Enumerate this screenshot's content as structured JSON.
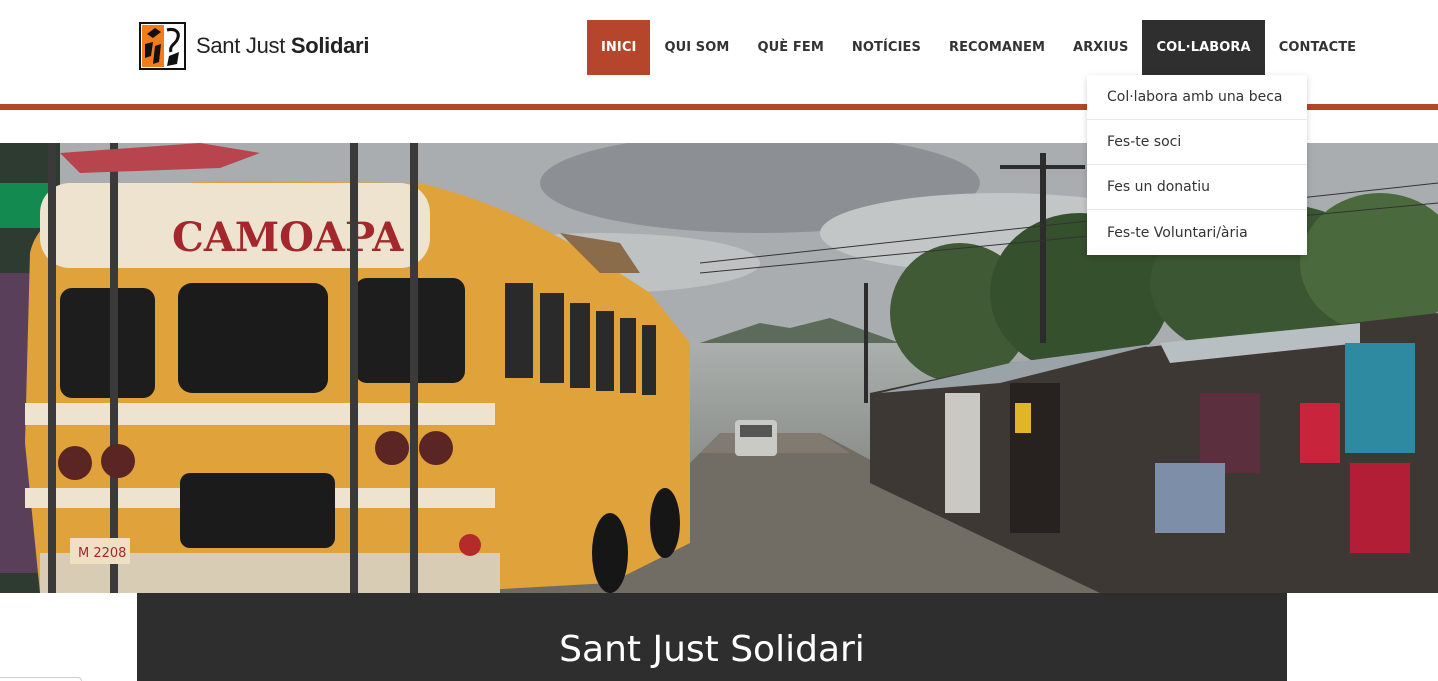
{
  "site": {
    "logo_name_regular": "Sant Just",
    "logo_name_bold": "Solidari",
    "logo_icon": "sant-just-solidari-logo-icon",
    "accent_color": "#b5462b",
    "dark_color": "#2f2f2f"
  },
  "nav": {
    "items": [
      {
        "label": "INICI",
        "state": "active"
      },
      {
        "label": "QUI SOM"
      },
      {
        "label": "QUÈ FEM"
      },
      {
        "label": "NOTÍCIES"
      },
      {
        "label": "RECOMANEM"
      },
      {
        "label": "ARXIUS"
      },
      {
        "label": "COL·LABORA",
        "state": "open"
      },
      {
        "label": "CONTACTE"
      }
    ]
  },
  "dropdown": {
    "items": [
      {
        "label": "Col·labora amb una beca"
      },
      {
        "label": "Fes-te soci"
      },
      {
        "label": "Fes un donatiu"
      },
      {
        "label": "Fes-te Voluntari/ària"
      }
    ]
  },
  "hero": {
    "bus_sign": "CAMOAPA",
    "bus_plate": "M 2208"
  },
  "page": {
    "title": "Sant Just Solidari"
  }
}
